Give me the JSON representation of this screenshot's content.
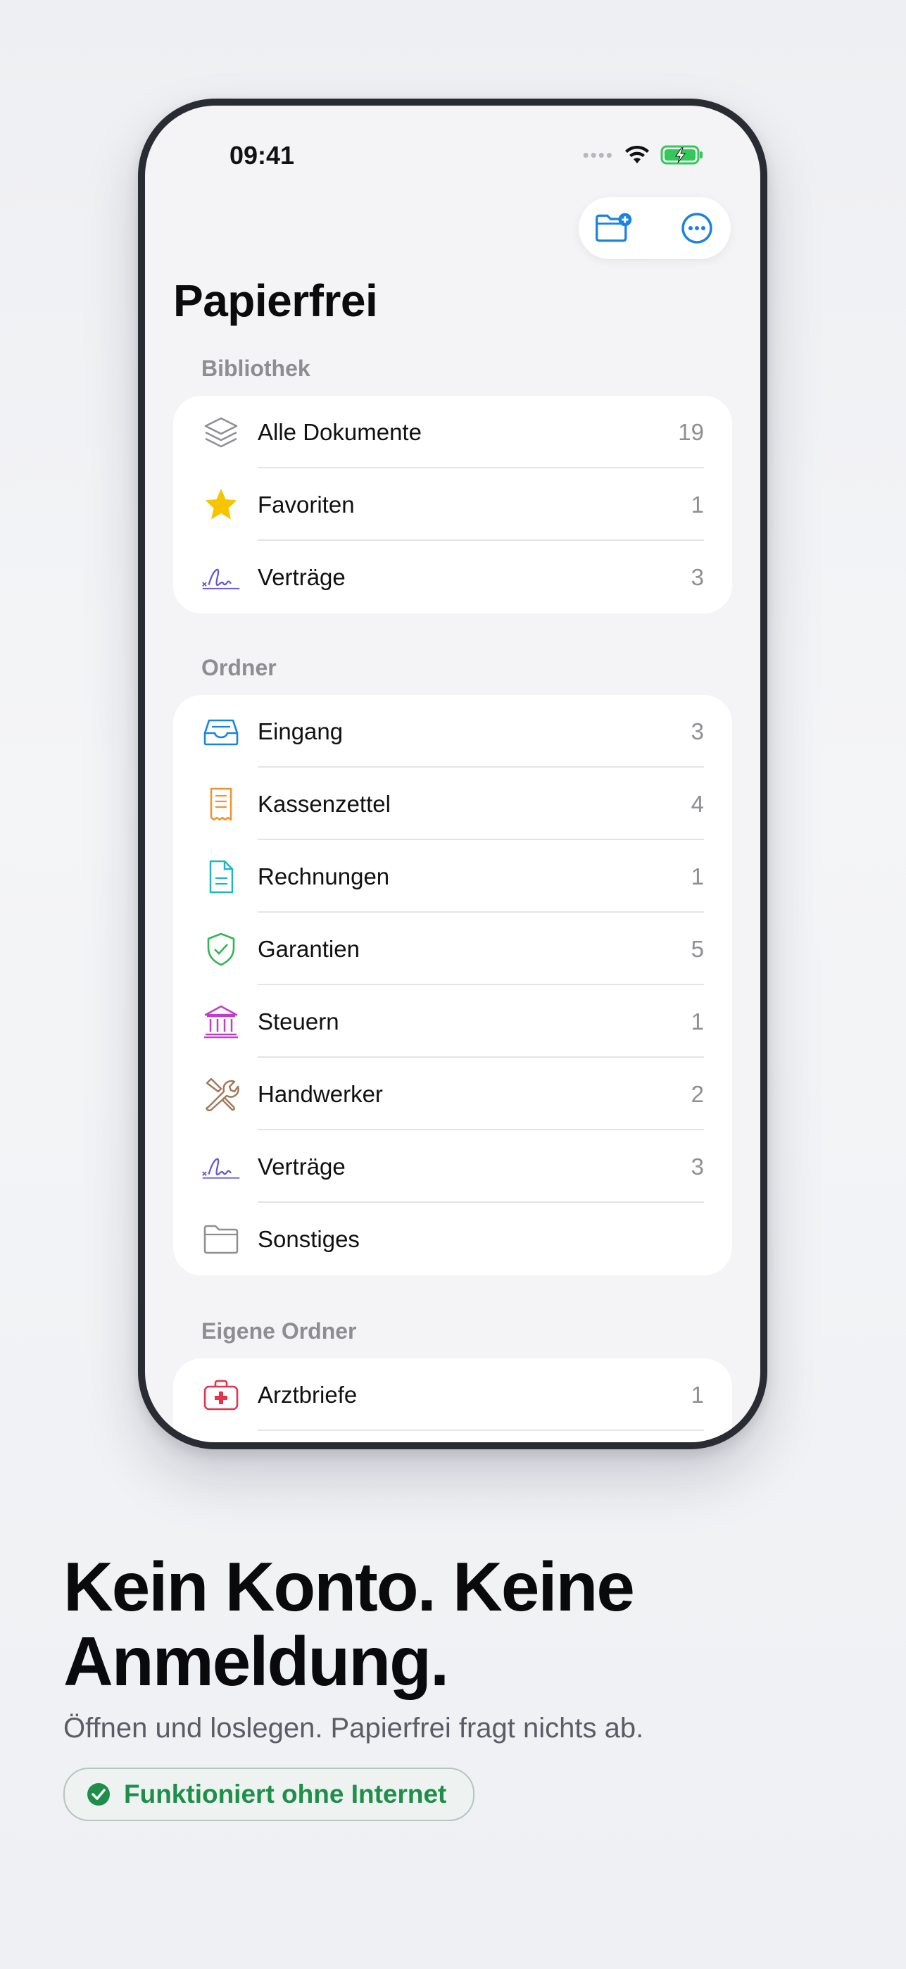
{
  "status_bar": {
    "time": "09:41"
  },
  "app": {
    "title": "Papierfrei"
  },
  "toolbar": {
    "new_folder_icon": "folder-plus-icon",
    "more_icon": "ellipsis-circle-icon"
  },
  "sections": {
    "library": {
      "label": "Bibliothek",
      "items": [
        {
          "label": "Alle Dokumente",
          "count": "19",
          "icon": "layers-icon"
        },
        {
          "label": "Favoriten",
          "count": "1",
          "icon": "star-icon"
        },
        {
          "label": "Verträge",
          "count": "3",
          "icon": "signature-icon"
        }
      ]
    },
    "folders": {
      "label": "Ordner",
      "items": [
        {
          "label": "Eingang",
          "count": "3",
          "icon": "inbox-tray-icon"
        },
        {
          "label": "Kassenzettel",
          "count": "4",
          "icon": "receipt-icon"
        },
        {
          "label": "Rechnungen",
          "count": "1",
          "icon": "document-icon"
        },
        {
          "label": "Garantien",
          "count": "5",
          "icon": "shield-check-icon"
        },
        {
          "label": "Steuern",
          "count": "1",
          "icon": "bank-icon"
        },
        {
          "label": "Handwerker",
          "count": "2",
          "icon": "tools-icon"
        },
        {
          "label": "Verträge",
          "count": "3",
          "icon": "signature-icon"
        },
        {
          "label": "Sonstiges",
          "count": "",
          "icon": "folder-icon"
        }
      ]
    },
    "custom": {
      "label": "Eigene Ordner",
      "items": [
        {
          "label": "Arztbriefe",
          "count": "1",
          "icon": "medical-kit-icon"
        }
      ]
    }
  },
  "marketing": {
    "headline_line1": "Kein Konto. Keine",
    "headline_line2": "Anmeldung.",
    "subline": "Öffnen und loslegen. Papierfrei fragt nichts ab.",
    "badge": "Funktioniert ohne Internet"
  },
  "colors": {
    "accent": "#1a82e0",
    "star": "#f7c400",
    "signature": "#6257d6",
    "receipt": "#f0922e",
    "document": "#22b4c4",
    "shield": "#33b556",
    "bank": "#c03cc9",
    "tools": "#a0785a",
    "folder": "#8e8e93",
    "medical": "#e5334b",
    "badge_green": "#1e8e4a"
  }
}
